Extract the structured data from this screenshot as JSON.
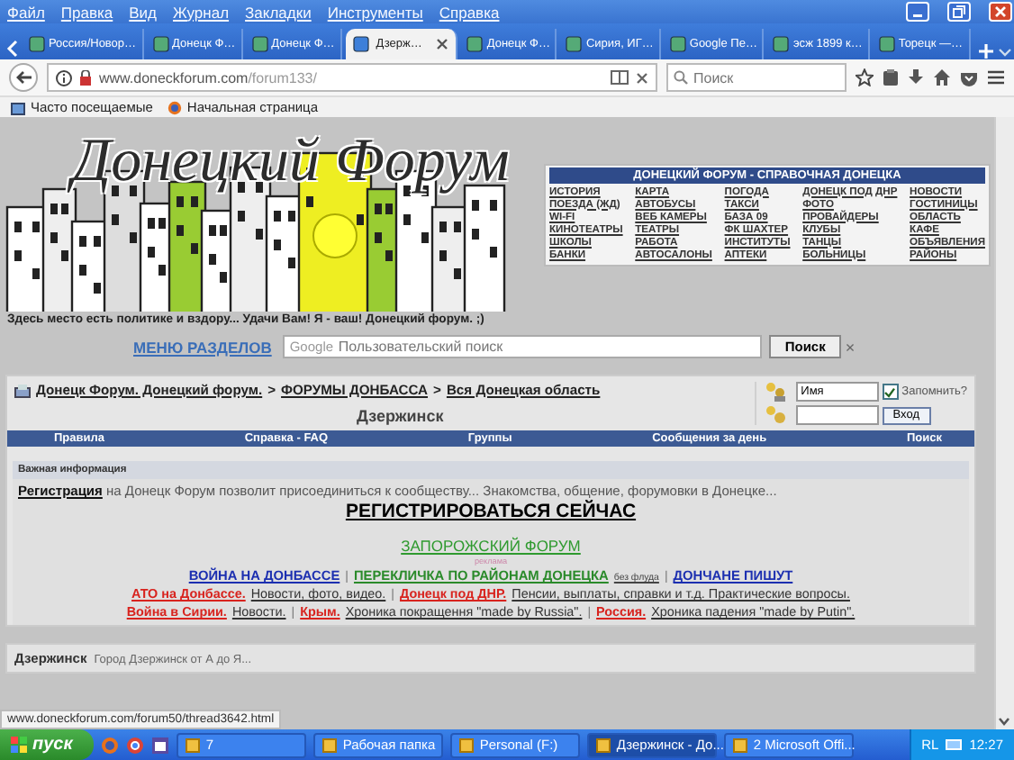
{
  "menu": [
    "Файл",
    "Правка",
    "Вид",
    "Журнал",
    "Закладки",
    "Инструменты",
    "Справка"
  ],
  "tabs": [
    {
      "label": "Россия/Новор…",
      "selected": false
    },
    {
      "label": "Донецк Ф…",
      "selected": false
    },
    {
      "label": "Донецк Ф…",
      "selected": false
    },
    {
      "label": "Дзерж…",
      "selected": true
    },
    {
      "label": "Донецк Ф…",
      "selected": false
    },
    {
      "label": "Сирия, ИГ…",
      "selected": false
    },
    {
      "label": "Google Пе…",
      "selected": false
    },
    {
      "label": "эсж 1899 к…",
      "selected": false
    },
    {
      "label": "Торецк —…",
      "selected": false
    }
  ],
  "address": {
    "host": "www.doneckforum.com",
    "path": "/forum133/"
  },
  "search": {
    "placeholder": "Поиск"
  },
  "bookmarks": [
    "Часто посещаемые",
    "Начальная страница"
  ],
  "logo": {
    "title": "Донецкий Форум"
  },
  "directory": {
    "title": "ДОНЕЦКИЙ ФОРУМ - СПРАВОЧНАЯ ДОНЕЦКА",
    "rows": [
      [
        "ИСТОРИЯ",
        "КАРТА",
        "ПОГОДА",
        "ДОНЕЦК ПОД ДНР",
        "НОВОСТИ"
      ],
      [
        "ПОЕЗДА (ЖД)",
        "АВТОБУСЫ",
        "ТАКСИ",
        "ФОТО",
        "ГОСТИНИЦЫ"
      ],
      [
        "WI-FI",
        "ВЕБ КАМЕРЫ",
        "БАЗА 09",
        "ПРОВАЙДЕРЫ",
        "ОБЛАСТЬ"
      ],
      [
        "КИНОТЕАТРЫ",
        "ТЕАТРЫ",
        "ФК ШАХТЕР",
        "КЛУБЫ",
        "КАФЕ"
      ],
      [
        "ШКОЛЫ",
        "РАБОТА",
        "ИНСТИТУТЫ",
        "ТАНЦЫ",
        "ОБЪЯВЛЕНИЯ"
      ],
      [
        "БАНКИ",
        "АВТОСАЛОНЫ",
        "АПТЕКИ",
        "БОЛЬНИЦЫ",
        "РАЙОНЫ"
      ]
    ]
  },
  "tagline": "Здесь место есть политике и вздору... Удачи Вам! Я - ваш! Донецкий форум. ;)",
  "menu_link": "МЕНЮ РАЗДЕЛОВ",
  "site_search": {
    "brand": "Google",
    "placeholder": "Пользовательский поиск",
    "button": "Поиск",
    "clear": "×"
  },
  "breadcrumb": [
    "Донецк Форум. Донецкий форум.",
    "ФОРУМЫ ДОНБАССА",
    "Вся Донецкая область"
  ],
  "breadcrumb_separator": ">",
  "page_title": "Дзержинск",
  "login": {
    "username": "Имя",
    "remember_label": "Запомнить?",
    "remember": true,
    "button": "Вход"
  },
  "navbar": [
    "Правила",
    "Справка - FAQ",
    "Группы",
    "Сообщения за день",
    "Поиск"
  ],
  "notice": {
    "header": "Важная информация",
    "register_link": "Регистрация",
    "register_text": "на Донецк Форум позволит присоединиться к сообществу... Знакомства, общение, форумовки в Донецке...",
    "cta": "РЕГИСТРИРОВАТЬСЯ СЕЙЧАС",
    "promo": "ЗАПОРОЖСКИЙ ФОРУМ",
    "ad_label": "реклама",
    "lines": [
      [
        {
          "kind": "blue",
          "text": "ВОЙНА НА ДОНБАССЕ"
        },
        {
          "kind": "separator",
          "text": "|"
        },
        {
          "kind": "green",
          "text": "ПЕРЕКЛИЧКА ПО РАЙОНАМ ДОНЕЦКА"
        },
        {
          "kind": "note",
          "text": "без флуда"
        },
        {
          "kind": "separator",
          "text": "|"
        },
        {
          "kind": "blue",
          "text": "ДОНЧАНЕ ПИШУТ"
        }
      ],
      [
        {
          "kind": "red",
          "text": "АТО на Донбассе."
        },
        {
          "kind": "plain",
          "text": "Новости, фото, видео."
        },
        {
          "kind": "separator",
          "text": "|"
        },
        {
          "kind": "red",
          "text": "Донецк под ДНР."
        },
        {
          "kind": "plain",
          "text": "Пенсии, выплаты, справки и т.д. Практические вопросы."
        }
      ],
      [
        {
          "kind": "red",
          "text": "Война в Сирии."
        },
        {
          "kind": "plain",
          "text": "Новости."
        },
        {
          "kind": "separator",
          "text": "|"
        },
        {
          "kind": "red",
          "text": "Крым."
        },
        {
          "kind": "plain",
          "text": "Хроника покращення \"made by Russia\"."
        },
        {
          "kind": "separator",
          "text": "|"
        },
        {
          "kind": "red",
          "text": "Россия."
        },
        {
          "kind": "plain",
          "text": "Хроника падения \"made by Putin\"."
        }
      ]
    ]
  },
  "section": {
    "title": "Дзержинск",
    "description": "Город Дзержинск от А до Я..."
  },
  "status_url": "www.doneckforum.com/forum50/thread3642.html",
  "taskbar": {
    "start": "пуск",
    "items": [
      {
        "label": "7",
        "selected": false
      },
      {
        "label": "Рабочая папка",
        "selected": false
      },
      {
        "label": "Personal (F:)",
        "selected": false
      },
      {
        "label": "Дзержинск - До...",
        "selected": true
      },
      {
        "label": "2 Microsoft Offi...",
        "selected": false
      }
    ],
    "language": "RL",
    "clock": "12:27"
  }
}
